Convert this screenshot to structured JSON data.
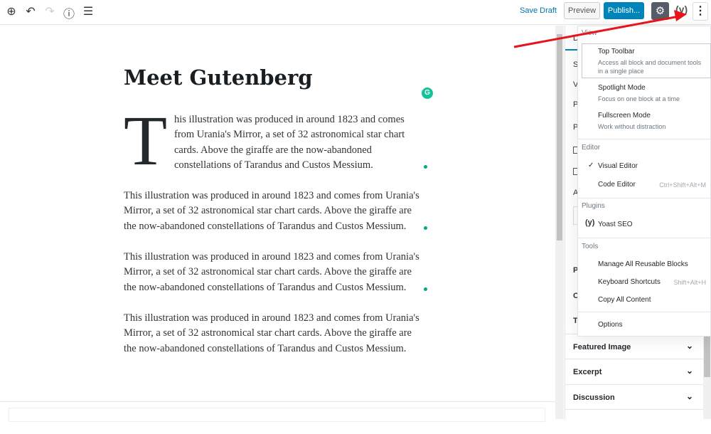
{
  "toolbar": {
    "add_icon": "plus-circle",
    "undo_icon": "undo",
    "redo_icon": "redo",
    "info_icon": "info",
    "outline_icon": "list",
    "save_draft": "Save Draft",
    "preview": "Preview",
    "publish": "Publish...",
    "settings_icon": "gear",
    "yoast_icon": "yoast-y",
    "more_icon": "vertical-ellipsis"
  },
  "post": {
    "title": "Meet Gutenberg",
    "dropcap": "T",
    "first_paragraph": "his illustration was produced in around 1823 and comes from Urania's Mirror, a set of 32 astronomical star chart cards. Above the giraffe are the now-abandoned constellations of Tarandus and Custos Messium.",
    "paragraphs": [
      "This illustration was produced in around 1823 and comes from Urania's Mirror, a set of 32 astronomical star chart cards. Above the giraffe are the now-abandoned constellations of Tarandus and Custos Messium.",
      "This illustration was produced in around 1823 and comes from Urania's Mirror, a set of 32 astronomical star chart cards. Above the giraffe are the now-abandoned constellations of Tarandus and Custos Messium.",
      "This illustration was produced in around 1823 and comes from Urania's Mirror, a set of 32 astronomical star chart cards. Above the giraffe are the now-abandoned constellations of Tarandus and Custos Messium."
    ],
    "grammarly": "G"
  },
  "sidebar": {
    "tab": "D",
    "letters": [
      "S",
      "V",
      "P",
      "P",
      "A",
      "P",
      "C",
      "T"
    ],
    "panels": [
      {
        "label": "Featured Image"
      },
      {
        "label": "Excerpt"
      },
      {
        "label": "Discussion"
      }
    ]
  },
  "menu": {
    "view": {
      "title": "View",
      "items": [
        {
          "label": "Top Toolbar",
          "desc": "Access all block and document tools in a single place"
        },
        {
          "label": "Spotlight Mode",
          "desc": "Focus on one block at a time"
        },
        {
          "label": "Fullscreen Mode",
          "desc": "Work without distraction"
        }
      ]
    },
    "editor": {
      "title": "Editor",
      "items": [
        {
          "label": "Visual Editor",
          "checked": true
        },
        {
          "label": "Code Editor",
          "shortcut": "Ctrl+Shift+Alt+M"
        }
      ]
    },
    "plugins": {
      "title": "Plugins",
      "items": [
        {
          "label": "Yoast SEO"
        }
      ]
    },
    "tools": {
      "title": "Tools",
      "items": [
        {
          "label": "Manage All Reusable Blocks"
        },
        {
          "label": "Keyboard Shortcuts",
          "shortcut": "Shift+Alt+H"
        },
        {
          "label": "Copy All Content"
        }
      ]
    },
    "options": "Options"
  },
  "colors": {
    "accent": "#0085ba",
    "annotation_arrow": "#e8141b",
    "grammarly": "#15c39a"
  }
}
